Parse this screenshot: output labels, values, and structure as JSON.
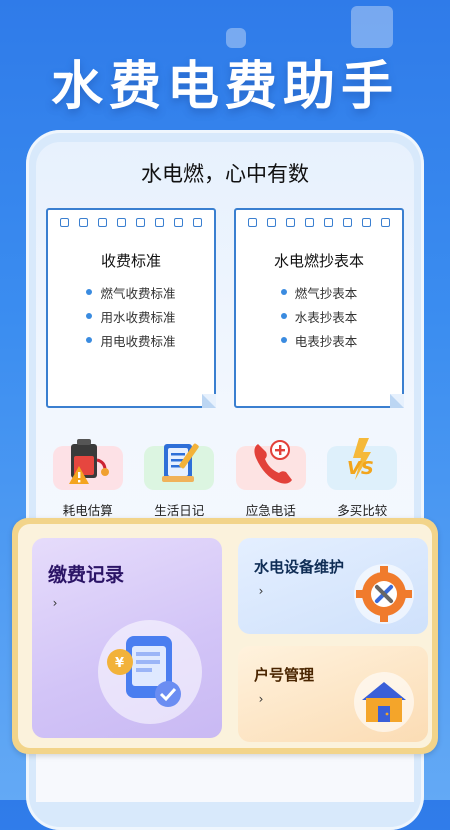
{
  "banner": {
    "title": "水费电费助手"
  },
  "tagline": "水电燃，心中有数",
  "notes": [
    {
      "title": "收费标准",
      "items": [
        "燃气收费标准",
        "用水收费标准",
        "用电收费标准"
      ]
    },
    {
      "title": "水电燃抄表本",
      "items": [
        "燃气抄表本",
        "水表抄表本",
        "电表抄表本"
      ]
    }
  ],
  "tools": [
    {
      "label": "耗电估算",
      "icon": "battery-warning-icon",
      "bg": "#fde1e6"
    },
    {
      "label": "生活日记",
      "icon": "notebook-pen-icon",
      "bg": "#dcf5e1"
    },
    {
      "label": "应急电话",
      "icon": "phone-icon",
      "bg": "#fde3e3"
    },
    {
      "label": "多买比较",
      "icon": "vs-icon",
      "bg": "#def0fb"
    }
  ],
  "cards": {
    "payment": {
      "title": "缴费记录",
      "chevron": "›",
      "icon": "bill-coin-icon"
    },
    "repair": {
      "title": "水电设备维护",
      "chevron": "›",
      "icon": "gear-tools-icon"
    },
    "account": {
      "title": "户号管理",
      "chevron": "›",
      "icon": "house-icon"
    }
  },
  "colors": {
    "brand_blue": "#2f7be9",
    "note_border": "#3a7fd0",
    "gold_panel": "#f2d48a"
  }
}
